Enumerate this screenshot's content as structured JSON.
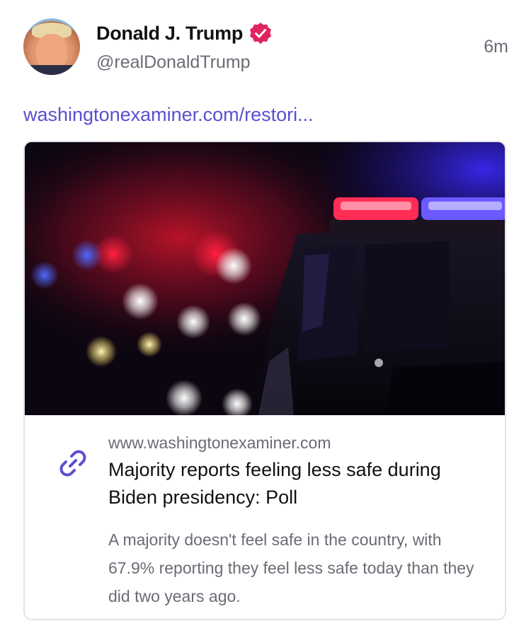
{
  "post": {
    "author_name": "Donald J. Trump",
    "author_handle": "@realDonaldTrump",
    "timestamp": "6m",
    "verified_icon": "verified-badge-icon",
    "link_text": "washingtonexaminer.com/restori..."
  },
  "link_card": {
    "domain": "www.washingtonexaminer.com",
    "title": "Majority reports feeling less safe during Biden presidency: Poll",
    "description": "A majority doesn't feel safe in the country, with 67.9% reporting they feel less safe today than they did two years ago.",
    "icon": "link-icon"
  },
  "colors": {
    "accent": "#5a4fcf",
    "verified": "#e0245e",
    "text_primary": "#111111",
    "text_secondary": "#6b6b76",
    "border": "#e2e2e7"
  }
}
